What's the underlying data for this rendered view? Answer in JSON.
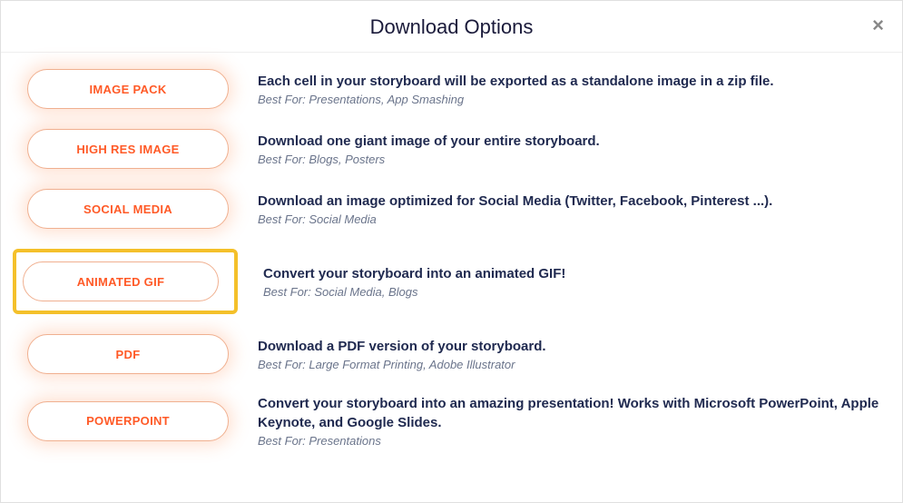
{
  "modal": {
    "title": "Download Options"
  },
  "options": [
    {
      "label": "IMAGE PACK",
      "title": "Each cell in your storyboard will be exported as a standalone image in a zip file.",
      "sub": "Best For: Presentations, App Smashing",
      "highlight": false
    },
    {
      "label": "HIGH RES IMAGE",
      "title": "Download one giant image of your entire storyboard.",
      "sub": "Best For: Blogs, Posters",
      "highlight": false
    },
    {
      "label": "SOCIAL MEDIA",
      "title": "Download an image optimized for Social Media (Twitter, Facebook, Pinterest ...).",
      "sub": "Best For: Social Media",
      "highlight": false
    },
    {
      "label": "ANIMATED GIF",
      "title": "Convert your storyboard into an animated GIF!",
      "sub": "Best For: Social Media, Blogs",
      "highlight": true
    },
    {
      "label": "PDF",
      "title": "Download a PDF version of your storyboard.",
      "sub": "Best For: Large Format Printing, Adobe Illustrator",
      "highlight": false
    },
    {
      "label": "POWERPOINT",
      "title": "Convert your storyboard into an amazing presentation! Works with Microsoft PowerPoint, Apple Keynote, and Google Slides.",
      "sub": "Best For: Presentations",
      "highlight": false
    }
  ]
}
